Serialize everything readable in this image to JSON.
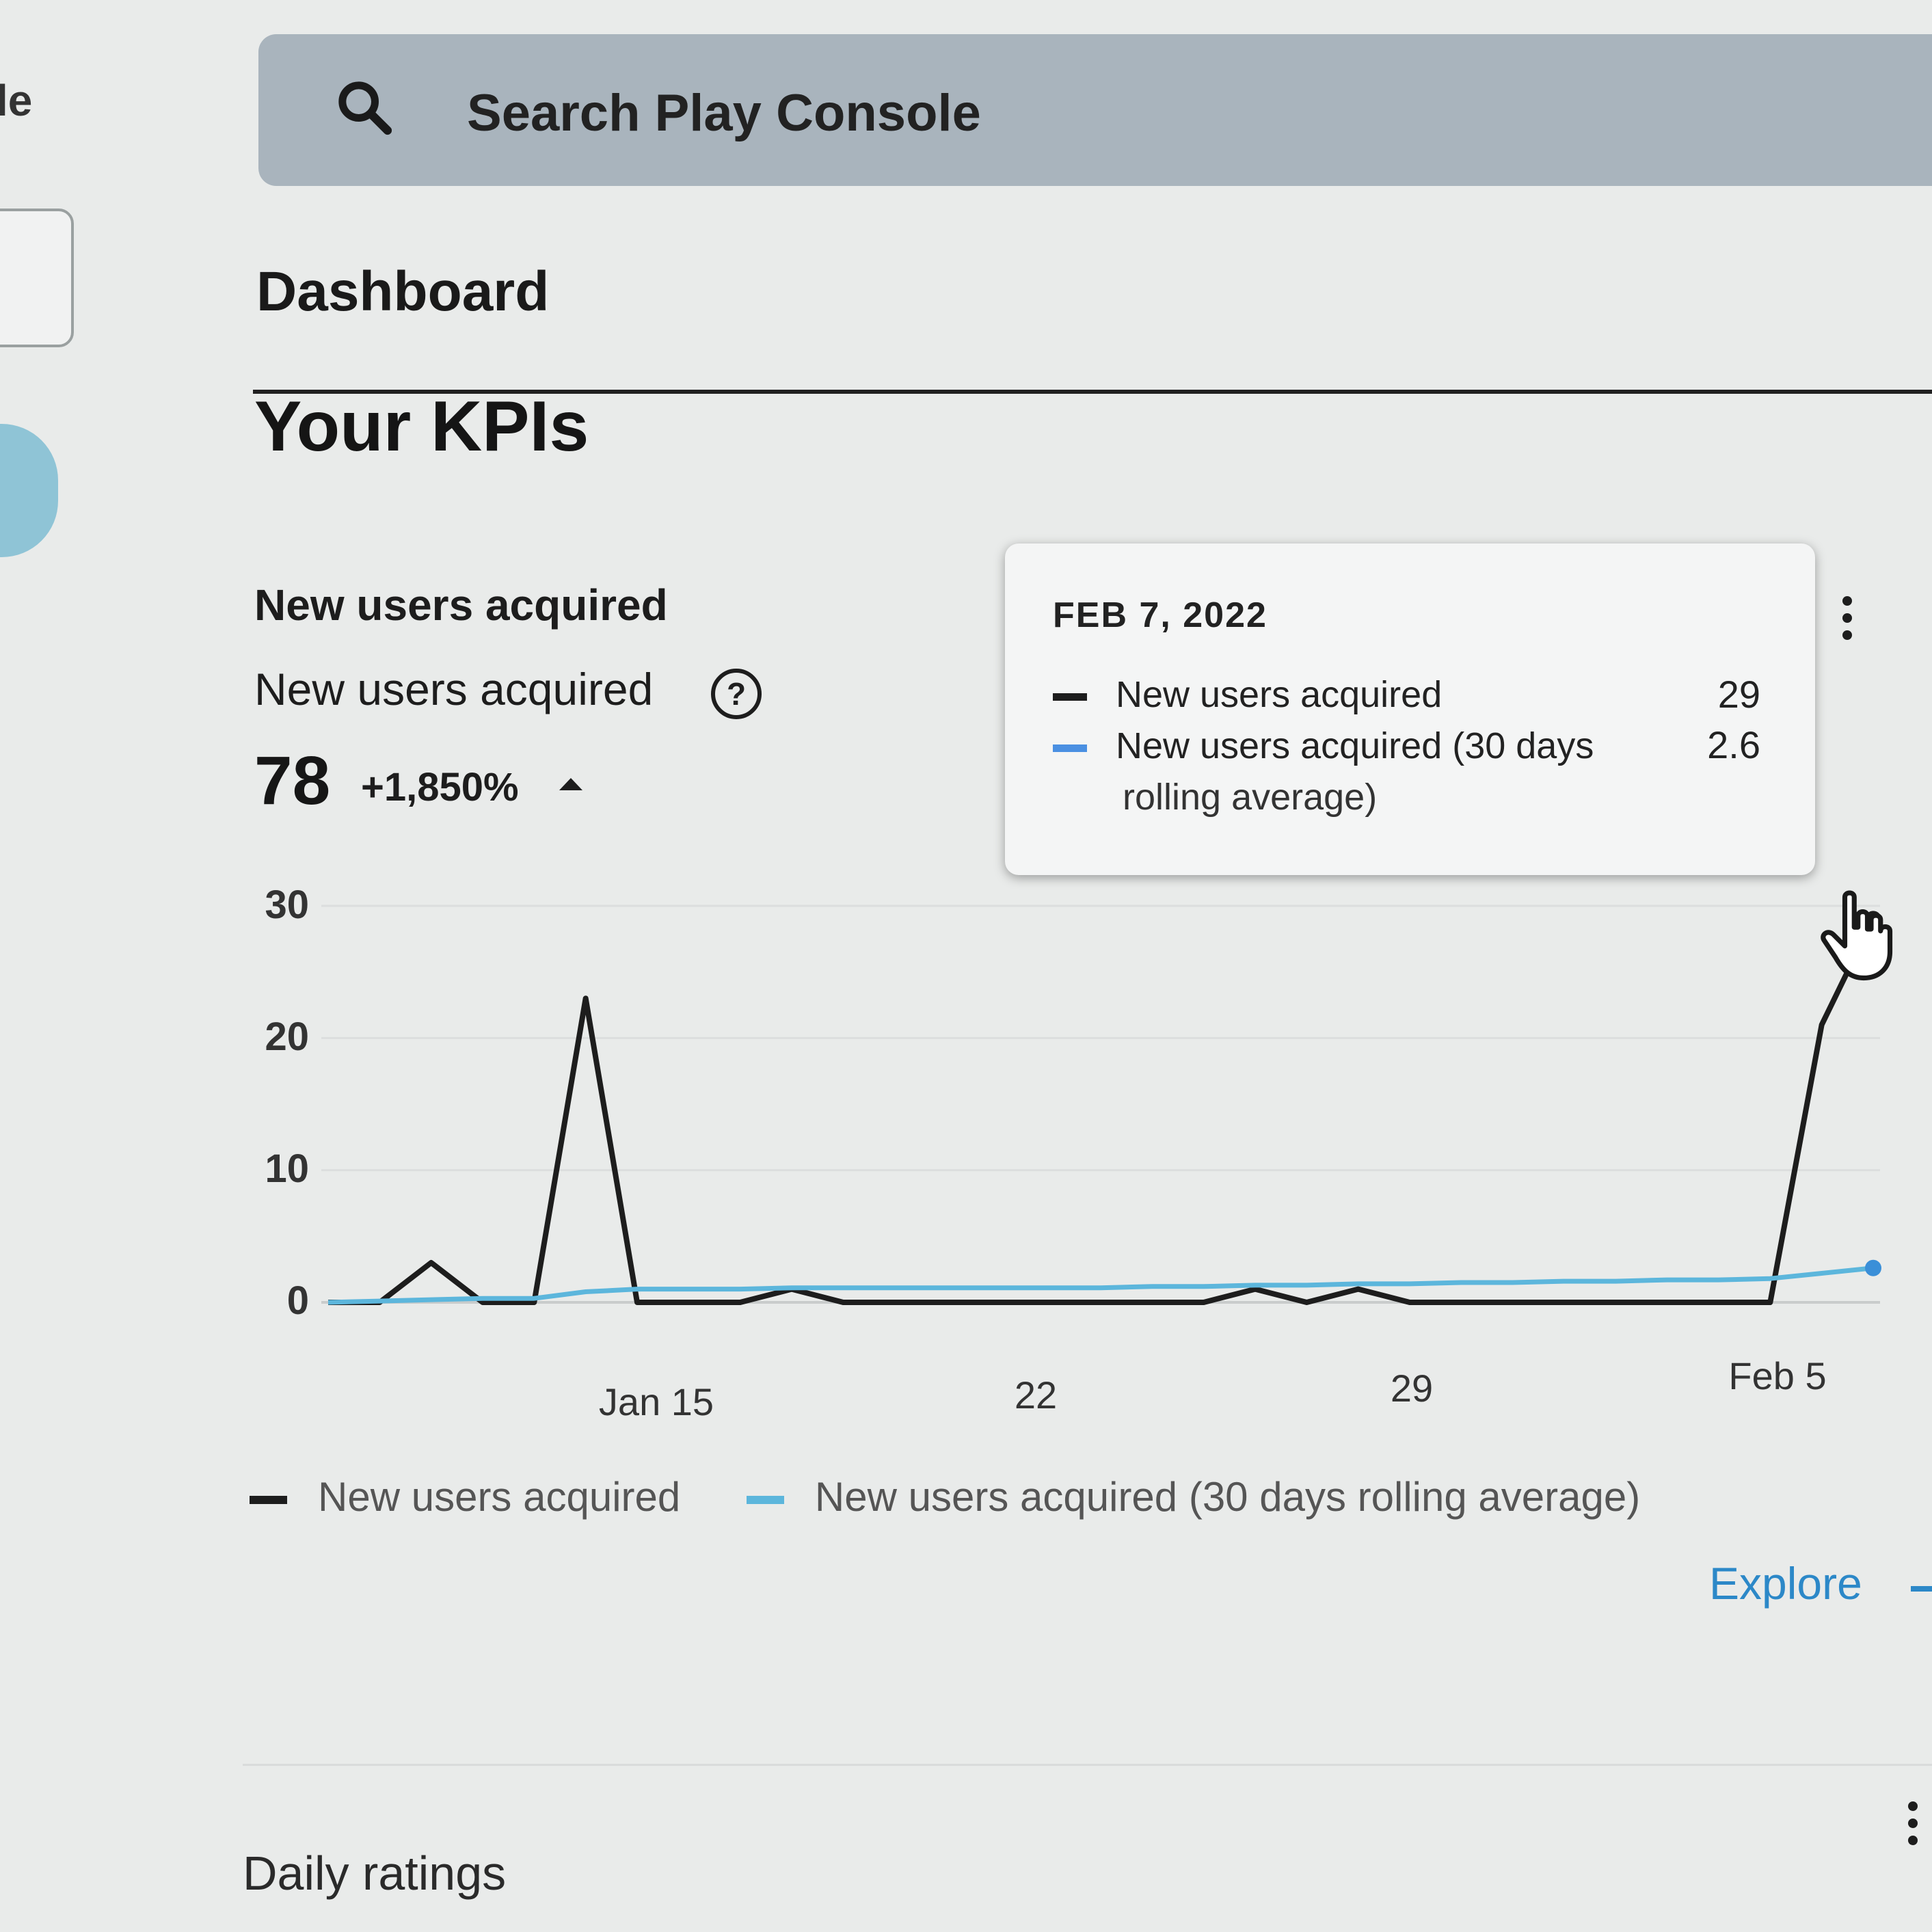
{
  "app": {
    "edge_label": "le"
  },
  "search": {
    "placeholder": "Search Play Console",
    "icon": "search-icon"
  },
  "page": {
    "title": "Dashboard",
    "section": "Your KPIs"
  },
  "kpi": {
    "header": "New users acquired",
    "metric_label": "New users acquired",
    "help_icon": "?",
    "value": "78",
    "change": "+1,850%",
    "trend": "up"
  },
  "tooltip": {
    "date": "FEB 7, 2022",
    "rows": [
      {
        "label": "New users acquired",
        "value": "29",
        "color": "#1d1d1d"
      },
      {
        "label": "New users acquired (30 days",
        "label_cont": "rolling average)",
        "value": "2.6",
        "color": "#4a90e2"
      }
    ]
  },
  "chart_data": {
    "type": "line",
    "y_ticks": [
      "30",
      "20",
      "10",
      "0"
    ],
    "x_ticks": [
      "Jan 15",
      "22",
      "29",
      "Feb 5"
    ],
    "ylim": [
      0,
      30
    ],
    "x": [
      "2022-01-08",
      "2022-01-09",
      "2022-01-10",
      "2022-01-11",
      "2022-01-12",
      "2022-01-13",
      "2022-01-14",
      "2022-01-15",
      "2022-01-16",
      "2022-01-17",
      "2022-01-18",
      "2022-01-19",
      "2022-01-20",
      "2022-01-21",
      "2022-01-22",
      "2022-01-23",
      "2022-01-24",
      "2022-01-25",
      "2022-01-26",
      "2022-01-27",
      "2022-01-28",
      "2022-01-29",
      "2022-01-30",
      "2022-01-31",
      "2022-02-01",
      "2022-02-02",
      "2022-02-03",
      "2022-02-04",
      "2022-02-05",
      "2022-02-06",
      "2022-02-07"
    ],
    "series": [
      {
        "name": "New users acquired",
        "color": "#1d1d1d",
        "values": [
          0,
          0,
          3,
          0,
          0,
          23,
          0,
          0,
          0,
          1,
          0,
          0,
          0,
          0,
          0,
          0,
          0,
          0,
          1,
          0,
          1,
          0,
          0,
          0,
          0,
          0,
          0,
          0,
          0,
          21,
          29
        ]
      },
      {
        "name": "New users acquired (30 days rolling average)",
        "color": "#5cb6dc",
        "values": [
          0,
          0.1,
          0.2,
          0.3,
          0.3,
          0.8,
          1.0,
          1.0,
          1.0,
          1.1,
          1.1,
          1.1,
          1.1,
          1.1,
          1.1,
          1.1,
          1.2,
          1.2,
          1.3,
          1.3,
          1.4,
          1.4,
          1.5,
          1.5,
          1.6,
          1.6,
          1.7,
          1.7,
          1.8,
          2.2,
          2.6
        ]
      }
    ]
  },
  "legend": [
    {
      "label": "New users acquired",
      "color": "#1d1d1d"
    },
    {
      "label": "New users acquired (30 days rolling average)",
      "color": "#5cb6dc"
    }
  ],
  "actions": {
    "explore": "Explore"
  },
  "next_section": {
    "title": "Daily ratings"
  }
}
